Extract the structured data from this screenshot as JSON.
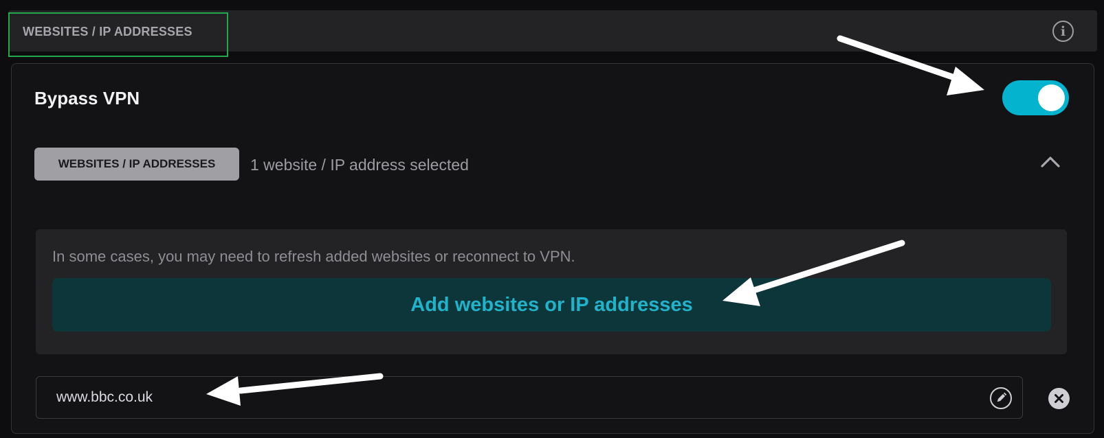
{
  "header": {
    "title": "WEBSITES / IP ADDRESSES",
    "info_icon": "info-icon"
  },
  "bypass": {
    "title": "Bypass VPN",
    "toggle_on": true,
    "toggle_color": "#04b4cf"
  },
  "selection": {
    "chip_label": "WEBSITES / IP ADDRESSES",
    "summary": "1 website / IP address selected",
    "expand_icon": "chevron-up-icon"
  },
  "notice": {
    "text": "In some cases, you may need to refresh added websites or reconnect to VPN.",
    "add_button_label": "Add websites or IP addresses",
    "accent_color": "#20b3c9"
  },
  "entries": [
    {
      "value": "www.bbc.co.uk",
      "edit_icon": "pencil-icon",
      "remove_icon": "close-icon"
    }
  ]
}
